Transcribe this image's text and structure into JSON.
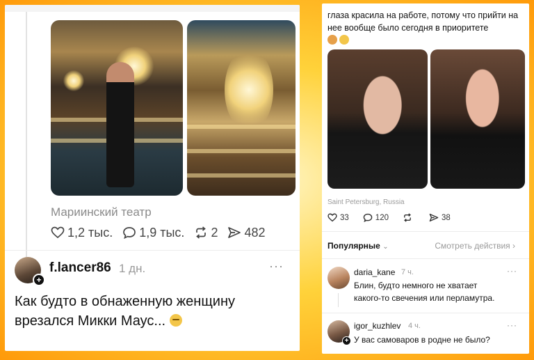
{
  "left_post": {
    "location": "Мариинский театр",
    "stats": {
      "likes": "1,2 тыс.",
      "comments": "1,9 тыс.",
      "reposts": "2",
      "shares": "482"
    },
    "comment": {
      "username": "f.lancer86",
      "time": "1 дн.",
      "text_line1": "Как будто в обнаженную женщину",
      "text_line2": "врезался Микки Маус...",
      "more": "···"
    }
  },
  "right_post": {
    "caption": "глаза красила на работе, потому что прийти на нее вообще было сегодня в приоритете",
    "location": "Saint Petersburg, Russia",
    "stats": {
      "likes": "33",
      "comments": "120",
      "shares": "38"
    },
    "sort_label": "Популярные",
    "actions_label": "Смотреть действия",
    "comments": [
      {
        "username": "daria_kane",
        "time": "7 ч.",
        "line1": "Блин, будто немного не хватает",
        "line2": "какого-то свечения или перламутра.",
        "more": "···"
      },
      {
        "username": "igor_kuzhlev",
        "time": "4 ч.",
        "line1": "У вас самоваров в родне не было?",
        "more": "···"
      }
    ]
  },
  "icons": [
    "heart-icon",
    "comment-icon",
    "repost-icon",
    "share-icon",
    "chevron-down-icon",
    "chevron-right-icon",
    "plus-icon",
    "more-icon"
  ]
}
